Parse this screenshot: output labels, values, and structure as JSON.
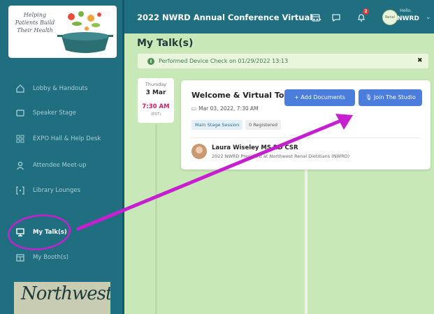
{
  "sidebar": {
    "logo_text": "Helping Patients Build Their Health",
    "items": [
      {
        "label": "Lobby & Handouts",
        "icon": "home-icon"
      },
      {
        "label": "Speaker Stage",
        "icon": "stage-icon"
      },
      {
        "label": "EXPO Hall & Help Desk",
        "icon": "grid-icon"
      },
      {
        "label": "Attendee Meet-up",
        "icon": "person-icon"
      },
      {
        "label": "Library Lounges",
        "icon": "brackets-icon"
      },
      {
        "label": "My Talk(s)",
        "icon": "presentation-icon",
        "active": true
      },
      {
        "label": "My Booth(s)",
        "icon": "booth-icon"
      }
    ],
    "sponsor_logo_text": "Northwest"
  },
  "header": {
    "title": "2022 NWRD Annual Conference Virtual...",
    "notification_count": "2",
    "avatar_text": "Renal",
    "greeting": "Hello,",
    "user_name": "NWRD"
  },
  "main": {
    "page_title": "My Talk(s)",
    "device_check": "Performed Device Check on 01/29/2022 13:13",
    "date": {
      "day_of_week": "Thursday",
      "day": "3 Mar",
      "time": "7:30 AM",
      "timezone": "(PST)"
    },
    "session": {
      "title": "Welcome & Virtual Tour",
      "datetime": "Mar 03, 2022, 7:30 AM",
      "tags": [
        "Main Stage Session",
        "0 Registered"
      ],
      "add_documents_label": "Add Documents",
      "join_studio_label": "Join The Studio",
      "speaker_name": "Laura Wiseley MS RD CSR",
      "speaker_role": "2022 NWRD President at Northwest Renal Dietitians (NWRD)"
    }
  },
  "colors": {
    "sidebar": "#1f6f80",
    "background": "#c9e8b8",
    "button": "#4a7ddc",
    "annotation": "#c51fd0",
    "time_accent": "#d81b60"
  }
}
